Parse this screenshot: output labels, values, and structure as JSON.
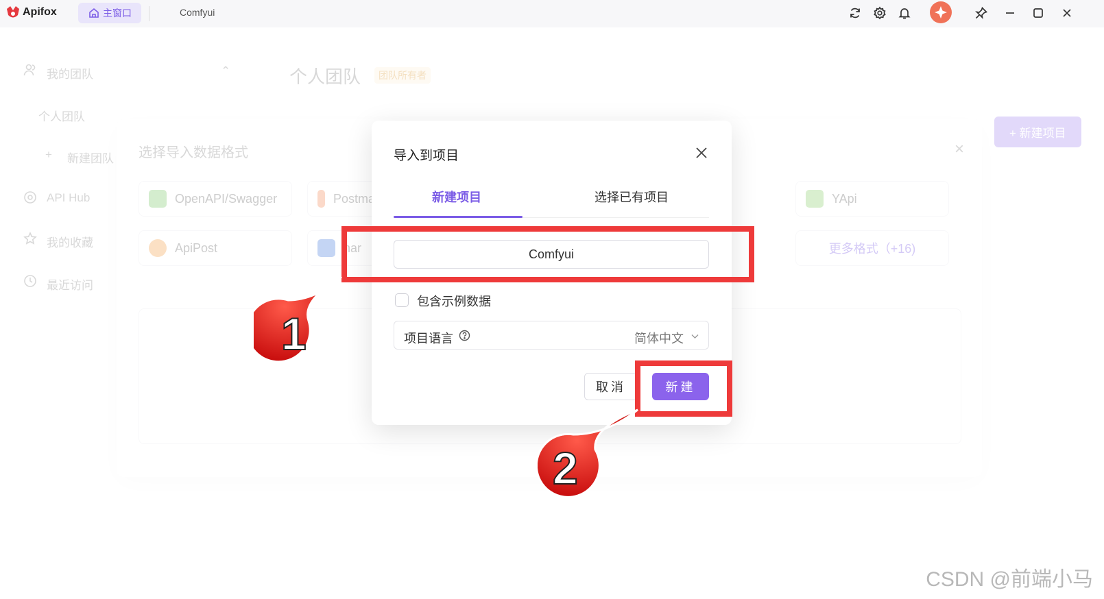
{
  "titlebar": {
    "app_name": "Apifox",
    "home_tab_label": "主窗口",
    "project_tab_label": "Comfyui"
  },
  "background": {
    "team_section": "我的团队",
    "team_item": "个人团队",
    "new_team": "新建团队",
    "api_hub": "API Hub",
    "favorites": "我的收藏",
    "recent": "最近访问",
    "header_title": "个人团队",
    "header_badge": "团队所有者",
    "new_project_button": "+ 新建项目",
    "import_panel_title": "选择导入数据格式",
    "formats": [
      {
        "label": "OpenAPI/Swagger",
        "icon": "swagger-icon"
      },
      {
        "label": "Postman",
        "icon": "postman-icon"
      },
      {
        "label": "YApi",
        "icon": "yapi-icon"
      },
      {
        "label": "ApiPost",
        "icon": "apipost-icon"
      },
      {
        "label": "har",
        "icon": "har-icon"
      },
      {
        "label": "更多格式（+16)",
        "icon": ""
      }
    ]
  },
  "modal": {
    "title": "导入到项目",
    "tabs": [
      {
        "label": "新建项目",
        "active": true
      },
      {
        "label": "选择已有项目",
        "active": false
      }
    ],
    "name_input_value": "Comfyui",
    "include_sample_label": "包含示例数据",
    "include_sample_checked": false,
    "language_label": "项目语言",
    "language_value": "简体中文",
    "cancel_label": "取消",
    "create_label": "新建"
  },
  "annotations": {
    "marker_1": "1",
    "marker_2": "2",
    "highlight_color": "#ee3a3a"
  },
  "colors": {
    "accent": "#7b5ce6",
    "button_primary": "#8b63ec"
  },
  "watermark": "CSDN @前端小马"
}
